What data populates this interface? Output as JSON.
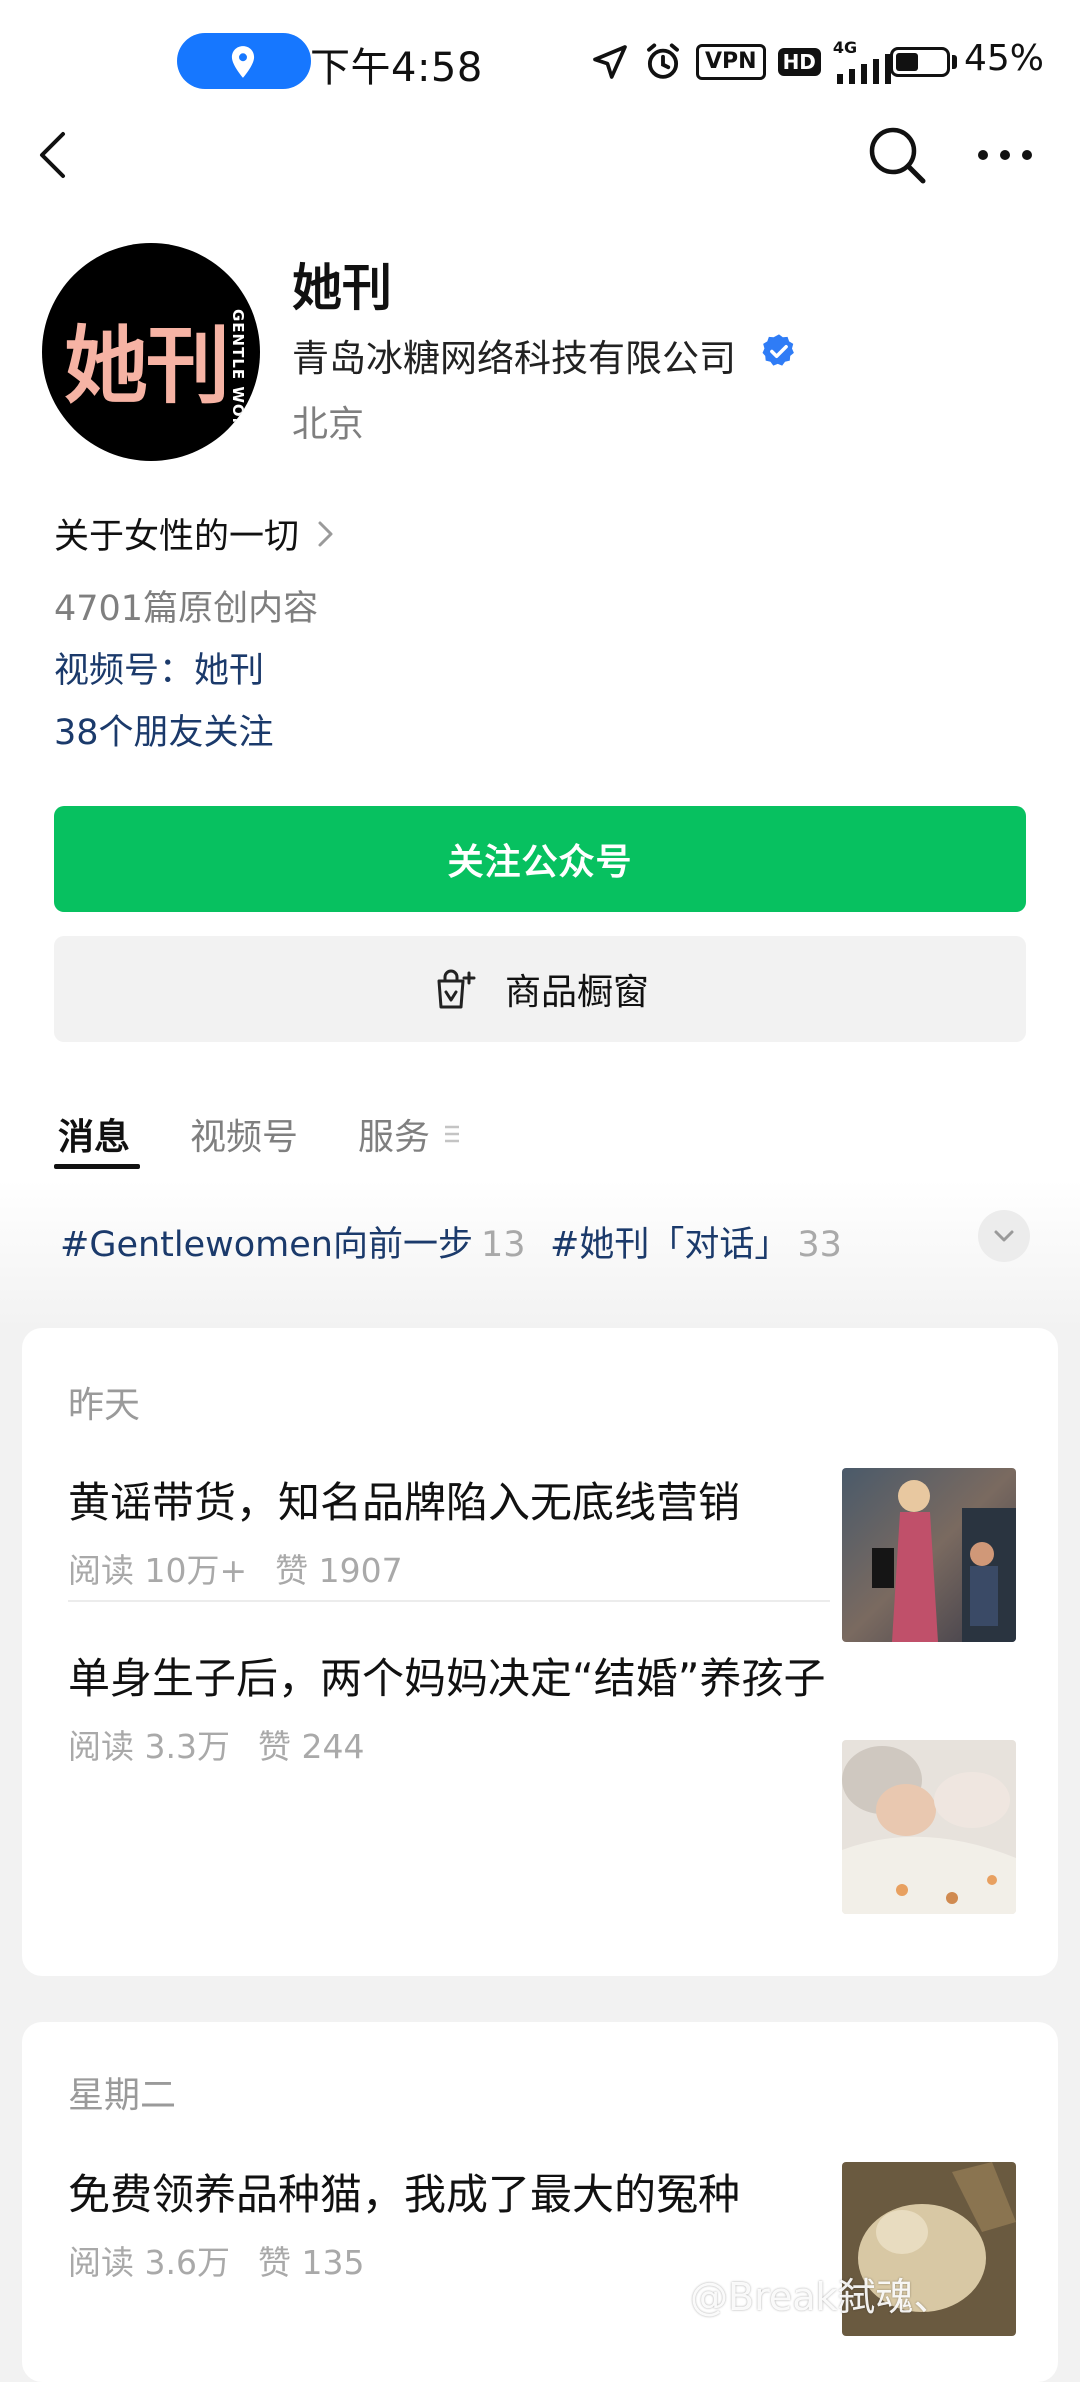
{
  "status_bar": {
    "time": "下午4:58",
    "vpn": "VPN",
    "hd": "HD",
    "network": "4G",
    "battery": "45%",
    "battery_level": 0.45
  },
  "nav": {
    "back_icon": "chevron-left-icon",
    "search_icon": "search-icon",
    "more_icon": "more-dots-icon"
  },
  "profile": {
    "avatar_text": "她刊",
    "avatar_sub": "GENTLE WOMEN",
    "name": "她刊",
    "company": "青岛冰糖网络科技有限公司",
    "region": "北京",
    "description": "关于女性的一切",
    "original_count": "4701篇原创内容",
    "channel": "视频号：她刊",
    "friends_follow": "38个朋友关注"
  },
  "buttons": {
    "follow": "关注公众号",
    "shop": "商品橱窗"
  },
  "tabs": [
    {
      "label": "消息",
      "active": true
    },
    {
      "label": "视频号",
      "active": false
    },
    {
      "label": "服务",
      "active": false
    }
  ],
  "tags": [
    {
      "label": "#Gentlewomen向前一步",
      "count": "13"
    },
    {
      "label": "#她刊「对话」",
      "count": "33"
    }
  ],
  "feed": [
    {
      "day": "昨天",
      "articles": [
        {
          "title": "黄谣带货，知名品牌陷入无底线营销",
          "reads": "阅读 10万+",
          "likes": "赞 1907"
        },
        {
          "title": "单身生子后，两个妈妈决定“结婚”养孩子",
          "reads": "阅读 3.3万",
          "likes": "赞 244"
        }
      ]
    },
    {
      "day": "星期二",
      "articles": [
        {
          "title": "免费领养品种猫，我成了最大的冤种",
          "reads": "阅读 3.6万",
          "likes": "赞 135"
        }
      ]
    }
  ],
  "watermark": "@Break弑魂、",
  "colors": {
    "accent_green": "#07c160",
    "link_blue": "#1b3a6b",
    "location_blue": "#1677ff",
    "verified_blue": "#2f7cf6"
  }
}
